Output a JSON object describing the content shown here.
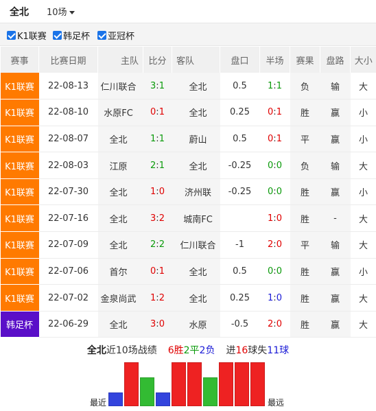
{
  "header": {
    "team": "全北",
    "count_label": "10场"
  },
  "filters": [
    {
      "label": "K1联赛",
      "checked": true
    },
    {
      "label": "韩足杯",
      "checked": true
    },
    {
      "label": "亚冠杯",
      "checked": true
    }
  ],
  "columns": [
    "赛事",
    "比赛日期",
    "主队",
    "比分",
    "客队",
    "盘口",
    "半场",
    "赛果",
    "盘路",
    "大小"
  ],
  "matches": [
    {
      "league": "K1联赛",
      "date": "22-08-13",
      "home": "仁川联合",
      "home_color": "dark",
      "score_h": "3",
      "score_a": "1",
      "score_color": "green",
      "away": "全北",
      "away_color": "red",
      "handicap": "0.5",
      "half_h": "1",
      "half_a": "1",
      "half_color": "green",
      "result": "负",
      "result_color": "blue",
      "cover": "输",
      "cover_color": "blue",
      "ou": "大",
      "ou_color": "red"
    },
    {
      "league": "K1联赛",
      "date": "22-08-10",
      "home": "水原FC",
      "home_color": "dark",
      "score_h": "0",
      "score_a": "1",
      "score_color": "red",
      "away": "全北",
      "away_color": "red",
      "handicap": "0.25",
      "half_h": "0",
      "half_a": "1",
      "half_color": "red",
      "result": "胜",
      "result_color": "red",
      "cover": "赢",
      "cover_color": "red",
      "ou": "小",
      "ou_color": "blue"
    },
    {
      "league": "K1联赛",
      "date": "22-08-07",
      "home": "全北",
      "home_color": "red",
      "score_h": "1",
      "score_a": "1",
      "score_color": "green",
      "away": "蔚山",
      "away_color": "dark",
      "handicap": "0.5",
      "half_h": "0",
      "half_a": "1",
      "half_color": "red",
      "result": "平",
      "result_color": "green",
      "cover": "赢",
      "cover_color": "red",
      "ou": "小",
      "ou_color": "blue"
    },
    {
      "league": "K1联赛",
      "date": "22-08-03",
      "home": "江原",
      "home_color": "dark",
      "score_h": "2",
      "score_a": "1",
      "score_color": "green",
      "away": "全北",
      "away_color": "red",
      "handicap": "-0.25",
      "half_h": "0",
      "half_a": "0",
      "half_color": "green",
      "result": "负",
      "result_color": "blue",
      "cover": "输",
      "cover_color": "blue",
      "ou": "大",
      "ou_color": "red"
    },
    {
      "league": "K1联赛",
      "date": "22-07-30",
      "home": "全北",
      "home_color": "red",
      "score_h": "1",
      "score_a": "0",
      "score_color": "red",
      "away": "济州联",
      "away_color": "dark",
      "handicap": "-0.25",
      "half_h": "0",
      "half_a": "0",
      "half_color": "green",
      "result": "胜",
      "result_color": "red",
      "cover": "赢",
      "cover_color": "red",
      "ou": "小",
      "ou_color": "blue"
    },
    {
      "league": "K1联赛",
      "date": "22-07-16",
      "home": "全北",
      "home_color": "red",
      "score_h": "3",
      "score_a": "2",
      "score_color": "red",
      "away": "城南FC",
      "away_color": "dark",
      "handicap": "",
      "half_h": "1",
      "half_a": "0",
      "half_color": "red",
      "result": "胜",
      "result_color": "red",
      "cover": "-",
      "cover_color": "gray",
      "ou": "大",
      "ou_color": "red"
    },
    {
      "league": "K1联赛",
      "date": "22-07-09",
      "home": "全北",
      "home_color": "red",
      "score_h": "2",
      "score_a": "2",
      "score_color": "green",
      "away": "仁川联合",
      "away_color": "dark",
      "handicap": "-1",
      "half_h": "2",
      "half_a": "0",
      "half_color": "red",
      "result": "平",
      "result_color": "green",
      "cover": "输",
      "cover_color": "blue",
      "ou": "大",
      "ou_color": "red"
    },
    {
      "league": "K1联赛",
      "date": "22-07-06",
      "home": "首尔",
      "home_color": "dark",
      "score_h": "0",
      "score_a": "1",
      "score_color": "red",
      "away": "全北",
      "away_color": "red",
      "handicap": "0.5",
      "half_h": "0",
      "half_a": "0",
      "half_color": "green",
      "result": "胜",
      "result_color": "red",
      "cover": "赢",
      "cover_color": "red",
      "ou": "小",
      "ou_color": "blue"
    },
    {
      "league": "K1联赛",
      "date": "22-07-02",
      "home": "金泉尚武",
      "home_color": "dark",
      "score_h": "1",
      "score_a": "2",
      "score_color": "red",
      "away": "全北",
      "away_color": "red",
      "handicap": "0.25",
      "half_h": "1",
      "half_a": "0",
      "half_color": "blue",
      "result": "胜",
      "result_color": "red",
      "cover": "赢",
      "cover_color": "red",
      "ou": "大",
      "ou_color": "red"
    },
    {
      "league": "韩足杯",
      "date": "22-06-29",
      "home": "全北",
      "home_color": "red",
      "score_h": "3",
      "score_a": "0",
      "score_color": "red",
      "away": "水原",
      "away_color": "dark",
      "handicap": "-0.5",
      "half_h": "2",
      "half_a": "0",
      "half_color": "red",
      "result": "胜",
      "result_color": "red",
      "cover": "赢",
      "cover_color": "red",
      "ou": "大",
      "ou_color": "red"
    }
  ],
  "summary": {
    "team": "全北",
    "recent_label": "近10场战绩",
    "wins": "6",
    "win_word": "胜",
    "draws": "2",
    "draw_word": "平",
    "losses": "2",
    "loss_word": "负",
    "scored_word": "进",
    "scored": "16",
    "ball_word": "球",
    "conceded_word": "失",
    "conceded": "11",
    "ball_word2": "球"
  },
  "trend": {
    "left_label": "最近",
    "right_label": "最远",
    "colors": {
      "win": "#ee2222",
      "draw": "#33bb33",
      "loss": "#3344dd"
    },
    "order": [
      "loss",
      "win",
      "draw",
      "loss",
      "win",
      "win",
      "draw",
      "win",
      "win",
      "win"
    ]
  }
}
